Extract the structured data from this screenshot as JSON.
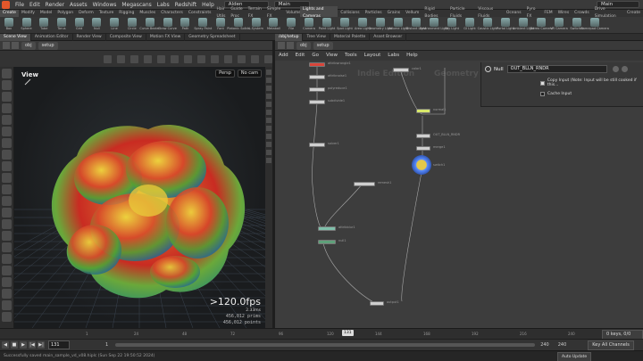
{
  "menu": {
    "items": [
      "File",
      "Edit",
      "Render",
      "Assets",
      "Windows",
      "Megascans",
      "Labs",
      "Redshift",
      "Help"
    ],
    "desktop": "Alden",
    "main_selector": "Main",
    "right_main": "Main"
  },
  "shelf_tabs_left": [
    "Create",
    "Modify",
    "Model",
    "Polygon",
    "Deform",
    "Texture",
    "Rigging",
    "Muscles",
    "Characters",
    "Constraints",
    "Hair Utils",
    "Guide Proc",
    "Terrain FX",
    "Simple FX",
    "Volume",
    "Personal"
  ],
  "shelf_tabs_right": [
    "Lights and Cameras",
    "Collisions",
    "Particles",
    "Grains",
    "Vellum",
    "Rigid Bodies",
    "Particle Fluids",
    "Viscous Fluids",
    "Oceans",
    "Pyro FX",
    "FEM",
    "Wires",
    "Crowds",
    "Drive Simulation",
    "Create"
  ],
  "tools_left": [
    "Box",
    "Sphere",
    "Tube",
    "Torus",
    "Grid",
    "Null",
    "Line",
    "Circle",
    "Curve Bezier",
    "Draw Curve",
    "Path",
    "Spray Paint",
    "Font",
    "Platonic Solids",
    "L-System",
    "Metaball",
    "File"
  ],
  "tools_right": [
    "Camera",
    "Point Light",
    "Spot Light",
    "Area Light",
    "Geometry Light",
    "Volume Light",
    "Distant Light",
    "Environment Light",
    "Sky Light",
    "GI Light",
    "Caustic Light",
    "Portal Light",
    "Ambient Light",
    "Stereo Camera",
    "VR Camera",
    "Switcher",
    "Gamepad Camera"
  ],
  "left_pane_tabs": [
    "Scene View",
    "Animation Editor",
    "Render View",
    "Composite View",
    "Motion FX View",
    "Geometry Spreadsheet"
  ],
  "right_pane_tabs": [
    "/obj/setup",
    "Tree View",
    "Material Palette",
    "Asset Browser"
  ],
  "left_path": [
    "obj",
    "setup"
  ],
  "right_path": [
    "obj",
    "setup"
  ],
  "viewport": {
    "title": "View",
    "persp": "Persp",
    "cam": "No cam",
    "fps": ">120.0fps",
    "ms": "2.33ms",
    "prims": "456,012  prims",
    "points": "456,012  points"
  },
  "network": {
    "menu": [
      "Add",
      "Edit",
      "Go",
      "View",
      "Tools",
      "Layout",
      "Labs",
      "Help"
    ],
    "watermark_left": "Indie Edition",
    "watermark_right": "Geometry",
    "nodes": [
      {
        "label": "attribwrangle1"
      },
      {
        "label": "attribnoise1"
      },
      {
        "label": "polyreduce1"
      },
      {
        "label": "subdivide1"
      },
      {
        "label": "solver1"
      },
      {
        "label": "remesh1"
      },
      {
        "label": "attribblur1"
      },
      {
        "label": "null1"
      },
      {
        "label": "color1"
      },
      {
        "label": "normal1"
      },
      {
        "label": "OUT_BLLN_RNDR"
      },
      {
        "label": "merge1"
      },
      {
        "label": "switch1"
      },
      {
        "label": "output1"
      }
    ]
  },
  "param": {
    "type": "Null",
    "name": "OUT_BLLN_RNDR",
    "copy_input_label": "Copy Input (Note: Input will be still cooked if this...",
    "cache_input_label": "Cache Input"
  },
  "timeline": {
    "ticks": [
      "1",
      "24",
      "48",
      "72",
      "96",
      "120",
      "144",
      "168",
      "192",
      "216",
      "240"
    ],
    "current_frame": "131",
    "current_frame_marker": "131",
    "start": "1",
    "end_a": "240",
    "end_b": "240",
    "keys_label": "0 keys, 0/0 channels",
    "key_all_label": "Key All Channels",
    "auto_update": "Auto Update"
  },
  "status": {
    "message": "Successfully saved main_sample_vd_v08.hiplc (Sun Sep 22 19:50:52 2024)"
  },
  "colors": {
    "accent": "#e3c84a",
    "selected_node": "#5a8cff"
  }
}
